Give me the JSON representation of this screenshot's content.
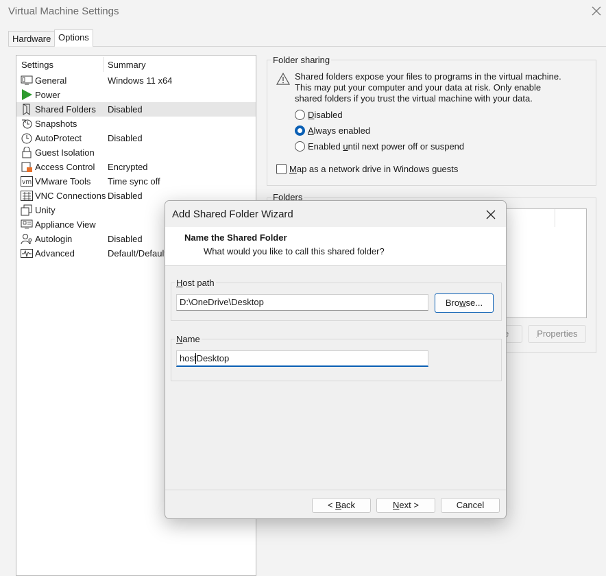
{
  "window": {
    "title": "Virtual Machine Settings"
  },
  "tabs": [
    {
      "label": "Hardware"
    },
    {
      "label": "Options"
    }
  ],
  "list": {
    "header_settings": "Settings",
    "header_summary": "Summary",
    "rows": [
      {
        "name": "General",
        "summary": "Windows 11 x64",
        "icon": "monitor-icon"
      },
      {
        "name": "Power",
        "summary": "",
        "icon": "play-icon"
      },
      {
        "name": "Shared Folders",
        "summary": "Disabled",
        "icon": "folder-icon"
      },
      {
        "name": "Snapshots",
        "summary": "",
        "icon": "snapshot-icon"
      },
      {
        "name": "AutoProtect",
        "summary": "Disabled",
        "icon": "clock-icon"
      },
      {
        "name": "Guest Isolation",
        "summary": "",
        "icon": "lock-icon"
      },
      {
        "name": "Access Control",
        "summary": "Encrypted",
        "icon": "access-control-icon"
      },
      {
        "name": "VMware Tools",
        "summary": "Time sync off",
        "icon": "vm-icon"
      },
      {
        "name": "VNC Connections",
        "summary": "Disabled",
        "icon": "vnc-icon"
      },
      {
        "name": "Unity",
        "summary": "",
        "icon": "unity-icon"
      },
      {
        "name": "Appliance View",
        "summary": "",
        "icon": "appliance-icon"
      },
      {
        "name": "Autologin",
        "summary": "Disabled",
        "icon": "user-key-icon"
      },
      {
        "name": "Advanced",
        "summary": "Default/Default",
        "icon": "waveform-icon"
      }
    ]
  },
  "folder_sharing": {
    "title": "Folder sharing",
    "warning": "Shared folders expose your files to programs in the virtual machine. This may put your computer and your data at risk. Only enable shared folders if you trust the virtual machine with your data.",
    "options": [
      {
        "pre": "",
        "u": "D",
        "post": "isabled",
        "selected": false
      },
      {
        "pre": "",
        "u": "A",
        "post": "lways enabled",
        "selected": true
      },
      {
        "pre": "Enabled ",
        "u": "u",
        "post": "ntil next power off or suspend",
        "selected": false
      }
    ],
    "map_drive_pre": "",
    "map_drive_u": "M",
    "map_drive_post": "ap as a network drive in Windows guests"
  },
  "folders": {
    "title": "Folders",
    "remove_tail": "e",
    "properties_label": "Properties"
  },
  "wizard": {
    "title": "Add Shared Folder Wizard",
    "heading": "Name the Shared Folder",
    "subheading": "What would you like to call this shared folder?",
    "host_path_label_u": "H",
    "host_path_label_rest": "ost path",
    "host_path_value": "D:\\OneDrive\\Desktop",
    "browse_u": "w",
    "browse_pre": "Bro",
    "browse_post": "se...",
    "name_label_u": "N",
    "name_label_rest": "ame",
    "name_value": "hostDesktop",
    "back_pre": "< ",
    "back_u": "B",
    "back_post": "ack",
    "next_u": "N",
    "next_post": "ext >",
    "cancel_label": "Cancel"
  },
  "colors": {
    "accent": "#0a5fb4",
    "power_green": "#2e9b2e"
  }
}
